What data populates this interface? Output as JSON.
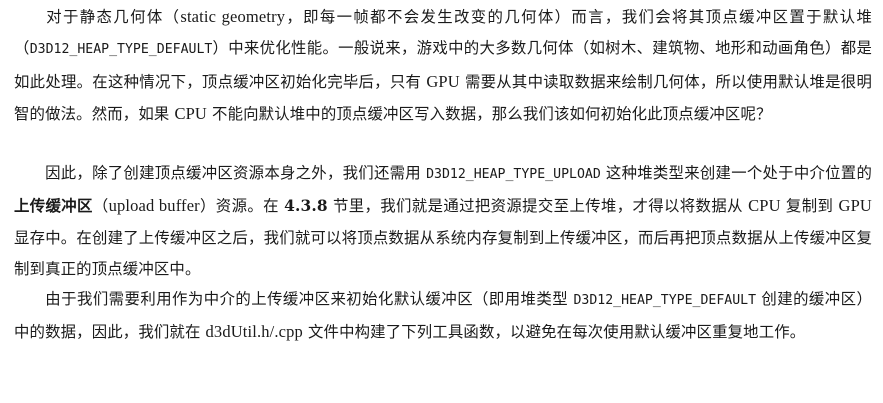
{
  "paragraphs": [
    {
      "segments": [
        {
          "type": "text",
          "text": "对于静态几何体（"
        },
        {
          "type": "latin",
          "text": "static geometry"
        },
        {
          "type": "text",
          "text": "，即每一帧都不会发生改变的几何体）而言，我们会将其顶点缓冲区置于默认堆（"
        },
        {
          "type": "mono",
          "text": "D3D12_HEAP_TYPE_DEFAULT"
        },
        {
          "type": "text",
          "text": "）中来优化性能。一般说来，游戏中的大多数几何体（如树木、建筑物、地形和动画角色）都是如此处理。在这种情况下，顶点缓冲区初始化完毕后，只有 "
        },
        {
          "type": "latin",
          "text": "GPU"
        },
        {
          "type": "text",
          "text": " 需要从其中读取数据来绘制几何体，所以使用默认堆是很明智的做法。然而，如果 "
        },
        {
          "type": "latin",
          "text": "CPU"
        },
        {
          "type": "text",
          "text": " 不能向默认堆中的顶点缓冲区写入数据，那么我们该如何初始化此顶点缓冲区呢？"
        }
      ]
    },
    {
      "segments": [
        {
          "type": "text",
          "text": "因此，除了创建顶点缓冲区资源本身之外，我们还需用 "
        },
        {
          "type": "mono",
          "text": "D3D12_HEAP_TYPE_UPLOAD"
        },
        {
          "type": "text",
          "text": " 这种堆类型来创建一个处于中介位置的"
        },
        {
          "type": "bold",
          "text": "上传缓冲区"
        },
        {
          "type": "text",
          "text": "（"
        },
        {
          "type": "latin",
          "text": "upload buffer"
        },
        {
          "type": "text",
          "text": "）资源。在 "
        },
        {
          "type": "bold",
          "text": "4.3.8"
        },
        {
          "type": "text",
          "text": " 节里，我们就是通过把资源提交至上传堆，才得以将数据从 "
        },
        {
          "type": "latin",
          "text": "CPU"
        },
        {
          "type": "text",
          "text": " 复制到 "
        },
        {
          "type": "latin",
          "text": "GPU"
        },
        {
          "type": "text",
          "text": " 显存中。在创建了上传缓冲区之后，我们就可以将顶点数据从系统内存复制到上传缓冲区，而后再把顶点数据从上传缓冲区复制到真正的顶点缓冲区中。"
        }
      ]
    },
    {
      "segments": [
        {
          "type": "text",
          "text": "由于我们需要利用作为中介的上传缓冲区来初始化默认缓冲区（即用堆类型 "
        },
        {
          "type": "mono",
          "text": "D3D12_HEAP_TYPE_DEFAULT"
        },
        {
          "type": "text",
          "text": " 创建的缓冲区）中的数据，因此，我们就在 "
        },
        {
          "type": "latin",
          "text": "d3dUtil.h/.cpp"
        },
        {
          "type": "text",
          "text": " 文件中构建了下列工具函数，以避免在每次使用默认缓冲区重复地工作。"
        }
      ]
    }
  ]
}
